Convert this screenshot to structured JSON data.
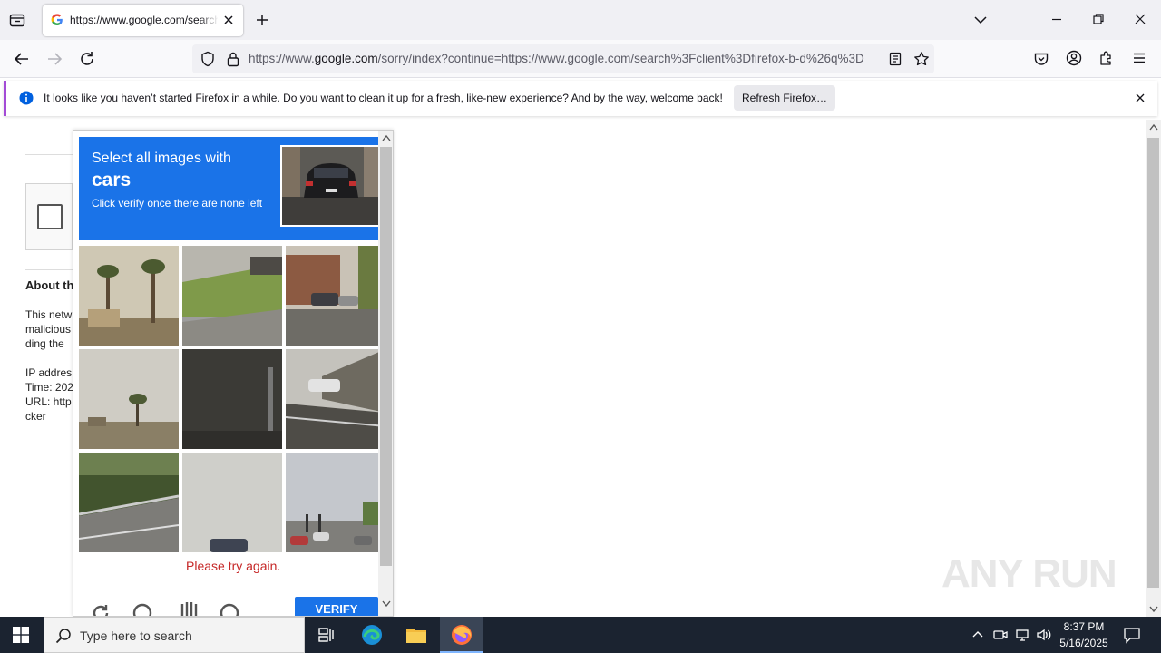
{
  "browser": {
    "tab": {
      "title": "https://www.google.com/search?client=firefox-b-d&q="
    },
    "url": {
      "prefix": "https://www.",
      "host": "google.com",
      "rest": "/sorry/index?continue=https://www.google.com/search%3Fclient%3Dfirefox-b-d%26q%3D"
    }
  },
  "notification": {
    "message": "It looks like you haven’t started Firefox in a while. Do you want to clean it up for a fresh, like-new experience? And by the way, welcome back!",
    "button": "Refresh Firefox…"
  },
  "page": {
    "about_heading": "About th",
    "lines": [
      "This netw",
      "malicious",
      "ding the"
    ],
    "ip": "IP addres",
    "time": "Time: 202",
    "url": "URL: http",
    "cker": "cker"
  },
  "captcha": {
    "intro": "Select all images with",
    "target": "cars",
    "sub": "Click verify once there are none left",
    "error": "Please try again.",
    "verify": "VERIFY"
  },
  "taskbar": {
    "search_placeholder": "Type here to search",
    "time": "8:37 PM",
    "date": "5/16/2025"
  },
  "watermark": "ANY RUN",
  "colors": {
    "accent": "#1a73e8",
    "error": "#c62828",
    "notification_border": "#a34bd6",
    "taskbar": "#1b2330"
  }
}
